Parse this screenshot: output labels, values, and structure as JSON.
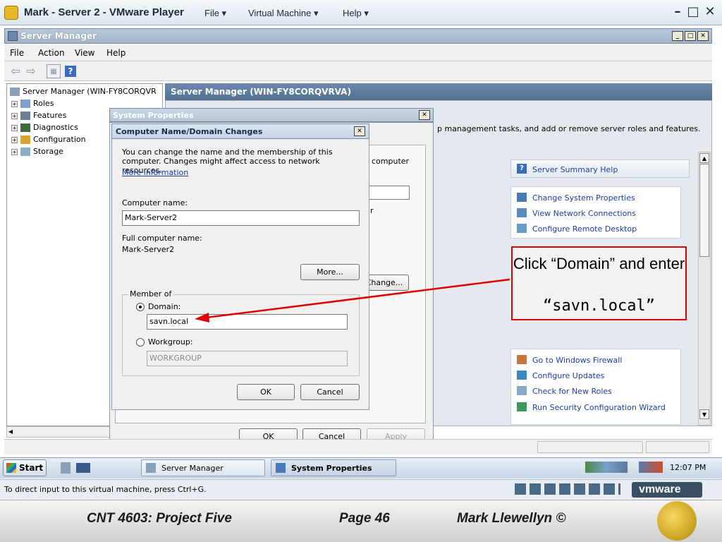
{
  "vmware": {
    "title": "Mark - Server 2 - VMware Player",
    "menu": [
      "File ▾",
      "Virtual Machine ▾",
      "Help ▾"
    ],
    "status": "To direct input to this virtual machine, press Ctrl+G.",
    "logo": "vmware"
  },
  "server_manager": {
    "title": "Server Manager",
    "menu": [
      "File",
      "Action",
      "View",
      "Help"
    ],
    "tree_root": "Server Manager (WIN-FY8CORQVR",
    "tree_items": [
      "Roles",
      "Features",
      "Diagnostics",
      "Configuration",
      "Storage"
    ],
    "main_header": "Server Manager (WIN-FY8CORQVRVA)",
    "description_fragment": "p management tasks, and add or remove server roles and features.",
    "help_link": "Server Summary Help",
    "links_top": [
      "Change System Properties",
      "View Network Connections",
      "Configure Remote Desktop"
    ],
    "links_bottom": [
      "Go to Windows Firewall",
      "Configure Updates",
      "Check for New Roles",
      "Run Security Configuration Wizard"
    ]
  },
  "system_properties": {
    "title": "System Properties",
    "frag_computer": "computer",
    "frag_r": "r",
    "change_button": "Change...",
    "ok": "OK",
    "cancel": "Cancel",
    "apply": "Apply"
  },
  "computer_name_dialog": {
    "title": "Computer Name/Domain Changes",
    "intro": "You can change the name and the membership of this computer. Changes might affect access to network resources.",
    "more_info": "More information",
    "computer_name_label": "Computer name:",
    "computer_name_value": "Mark-Server2",
    "full_name_label": "Full computer name:",
    "full_name_value": "Mark-Server2",
    "more_button": "More...",
    "member_of": "Member of",
    "domain_label": "Domain:",
    "domain_value": "savn.local",
    "workgroup_label": "Workgroup:",
    "workgroup_value": "WORKGROUP",
    "ok": "OK",
    "cancel": "Cancel"
  },
  "taskbar": {
    "start": "Start",
    "tasks": [
      "Server Manager",
      "System Properties"
    ],
    "clock": "12:07 PM"
  },
  "callout": {
    "line1": "Click “Domain” and enter",
    "line2": "“savn.local”"
  },
  "footer": {
    "course": "CNT 4603: Project Five",
    "page": "Page 46",
    "author": "Mark Llewellyn ©"
  },
  "colors": {
    "callout_border": "#e00000",
    "arrow": "#e00000",
    "link": "#1a3fa0"
  }
}
